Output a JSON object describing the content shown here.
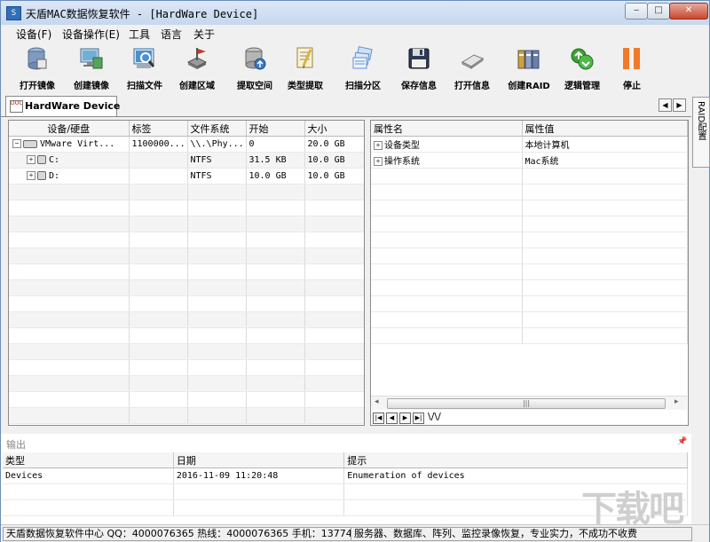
{
  "window": {
    "title": "天盾MAC数据恢复软件 - [HardWare Device]",
    "icon_text": "S",
    "controls": {
      "minimize": "‒",
      "maximize": "□",
      "close": "✕"
    }
  },
  "menu": [
    "设备(F)",
    "设备操作(E)",
    "工具",
    "语言",
    "关于"
  ],
  "toolbar": [
    {
      "label": "打开镜像",
      "icon": "open-image-icon",
      "color": "#6a8fb8"
    },
    {
      "label": "创建镜像",
      "icon": "create-image-icon",
      "color": "#4fa35a"
    },
    {
      "label": "扫描文件",
      "icon": "scan-file-icon",
      "color": "#3c7ec7"
    },
    {
      "label": "创建区域",
      "icon": "create-region-icon",
      "color": "#c0392b"
    },
    {
      "label": "提取空间",
      "icon": "extract-space-icon",
      "color": "#3a78c4"
    },
    {
      "label": "类型提取",
      "icon": "type-extract-icon",
      "color": "#d9b24a"
    },
    {
      "label": "扫描分区",
      "icon": "scan-partition-icon",
      "color": "#5b8fd0"
    },
    {
      "label": "保存信息",
      "icon": "save-info-icon",
      "color": "#2d3a5a"
    },
    {
      "label": "打开信息",
      "icon": "open-info-icon",
      "color": "#9a9a9a"
    },
    {
      "label": "创建RAID",
      "icon": "create-raid-icon",
      "color": "#6b7fa8"
    },
    {
      "label": "逻辑管理",
      "icon": "logic-manage-icon",
      "color": "#3aa335"
    },
    {
      "label": "停止",
      "icon": "stop-icon",
      "color": "#f07a2a"
    }
  ],
  "tab": {
    "label": "HardWare Device",
    "icon_text": "DOC"
  },
  "side_panel": {
    "label": "RAID配置"
  },
  "device_table": {
    "headers": [
      "设备/硬盘",
      "标签",
      "文件系统",
      "开始",
      "大小"
    ],
    "rows": [
      {
        "tree": "⊟",
        "device": "VMware Virt...",
        "label": "1100000...",
        "fs": "\\\\.\\Phy...",
        "start": "0",
        "size": "20.0 GB",
        "level": 0
      },
      {
        "tree": "⊞",
        "device": "C:",
        "label": "",
        "fs": "NTFS",
        "start": "31.5 KB",
        "size": "10.0 GB",
        "level": 1
      },
      {
        "tree": "⊞",
        "device": "D:",
        "label": "",
        "fs": "NTFS",
        "start": "10.0 GB",
        "size": "10.0 GB",
        "level": 1
      }
    ]
  },
  "property_table": {
    "headers": [
      "属性名",
      "属性值"
    ],
    "rows": [
      {
        "name": "设备类型",
        "value": "本地计算机"
      },
      {
        "name": "操作系统",
        "value": "Mac系统"
      }
    ]
  },
  "scroll": {
    "left": "◂",
    "right": "▸",
    "thumb": "|||"
  },
  "page_nav": [
    "|◀",
    "◀",
    "▶",
    "▶|"
  ],
  "page_tabs_glyph": "\\/\\/",
  "output": {
    "title": "输出",
    "headers": [
      "类型",
      "日期",
      "提示"
    ],
    "rows": [
      {
        "type": "Devices",
        "date": "2016-11-09 11:20:48",
        "hint": "Enumeration of devices"
      }
    ]
  },
  "watermark": "下载吧",
  "status": {
    "left": "天盾数据恢复软件中心 QQ：4000076365 热线：4000076365 手机：13774",
    "right": "服务器、数据库、阵列、监控录像恢复，专业实力，不成功不收费"
  }
}
